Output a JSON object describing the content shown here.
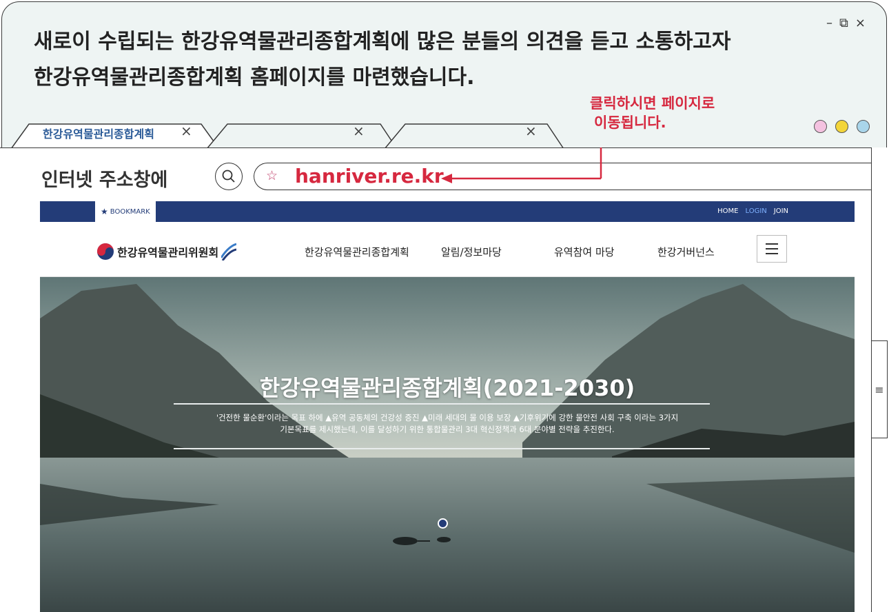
{
  "headline": {
    "line1": "새로이 수립되는 한강유역물관리종합계획에 많은 분들의 의견을 듣고 소통하고자",
    "line2": "한강유역물관리종합계획 홈페이지를 마련했습니다."
  },
  "window_controls": {
    "minimize": "–",
    "restore": "⧉",
    "close": "×"
  },
  "callout": {
    "line1": "클릭하시면 페이지로",
    "line2": "이동됩니다."
  },
  "dots": {
    "colors": [
      "#f4c2e0",
      "#f3d53a",
      "#a9d5ea"
    ]
  },
  "tabs": [
    {
      "label": "한강유역물관리종합계획",
      "close": "×"
    },
    {
      "label": "",
      "close": "×"
    },
    {
      "label": "",
      "close": "×"
    }
  ],
  "address_bar": {
    "label": "인터넷 주소창에",
    "url": "hanriver.re.kr"
  },
  "site": {
    "bookmark": "BOOKMARK",
    "top_links": [
      "HOME",
      "LOGIN",
      "JOIN"
    ],
    "logo_text": "한강유역물관리위원회",
    "menu": [
      "한강유역물관리종합계획",
      "알림/정보마당",
      "유역참여 마당",
      "한강거버넌스"
    ],
    "hero_title": "한강유역물관리종합계획(2021-2030)",
    "hero_desc_line1": "'건전한 물순환'이라는 목표 하에 ▲유역 공동체의 건강성 증진 ▲미래 세대의 물 이용 보장 ▲기후위기에 강한 물안전 사회 구축 이라는 3가지",
    "hero_desc_line2": "기본목표를 제시했는데, 이를 달성하기 위한 통합물관리 3대 혁신정책과 6대 분야별 전략을 추진한다."
  },
  "colors": {
    "accent_red": "#d6283f",
    "site_navy": "#233c78",
    "tab_blue": "#2b5b98"
  }
}
